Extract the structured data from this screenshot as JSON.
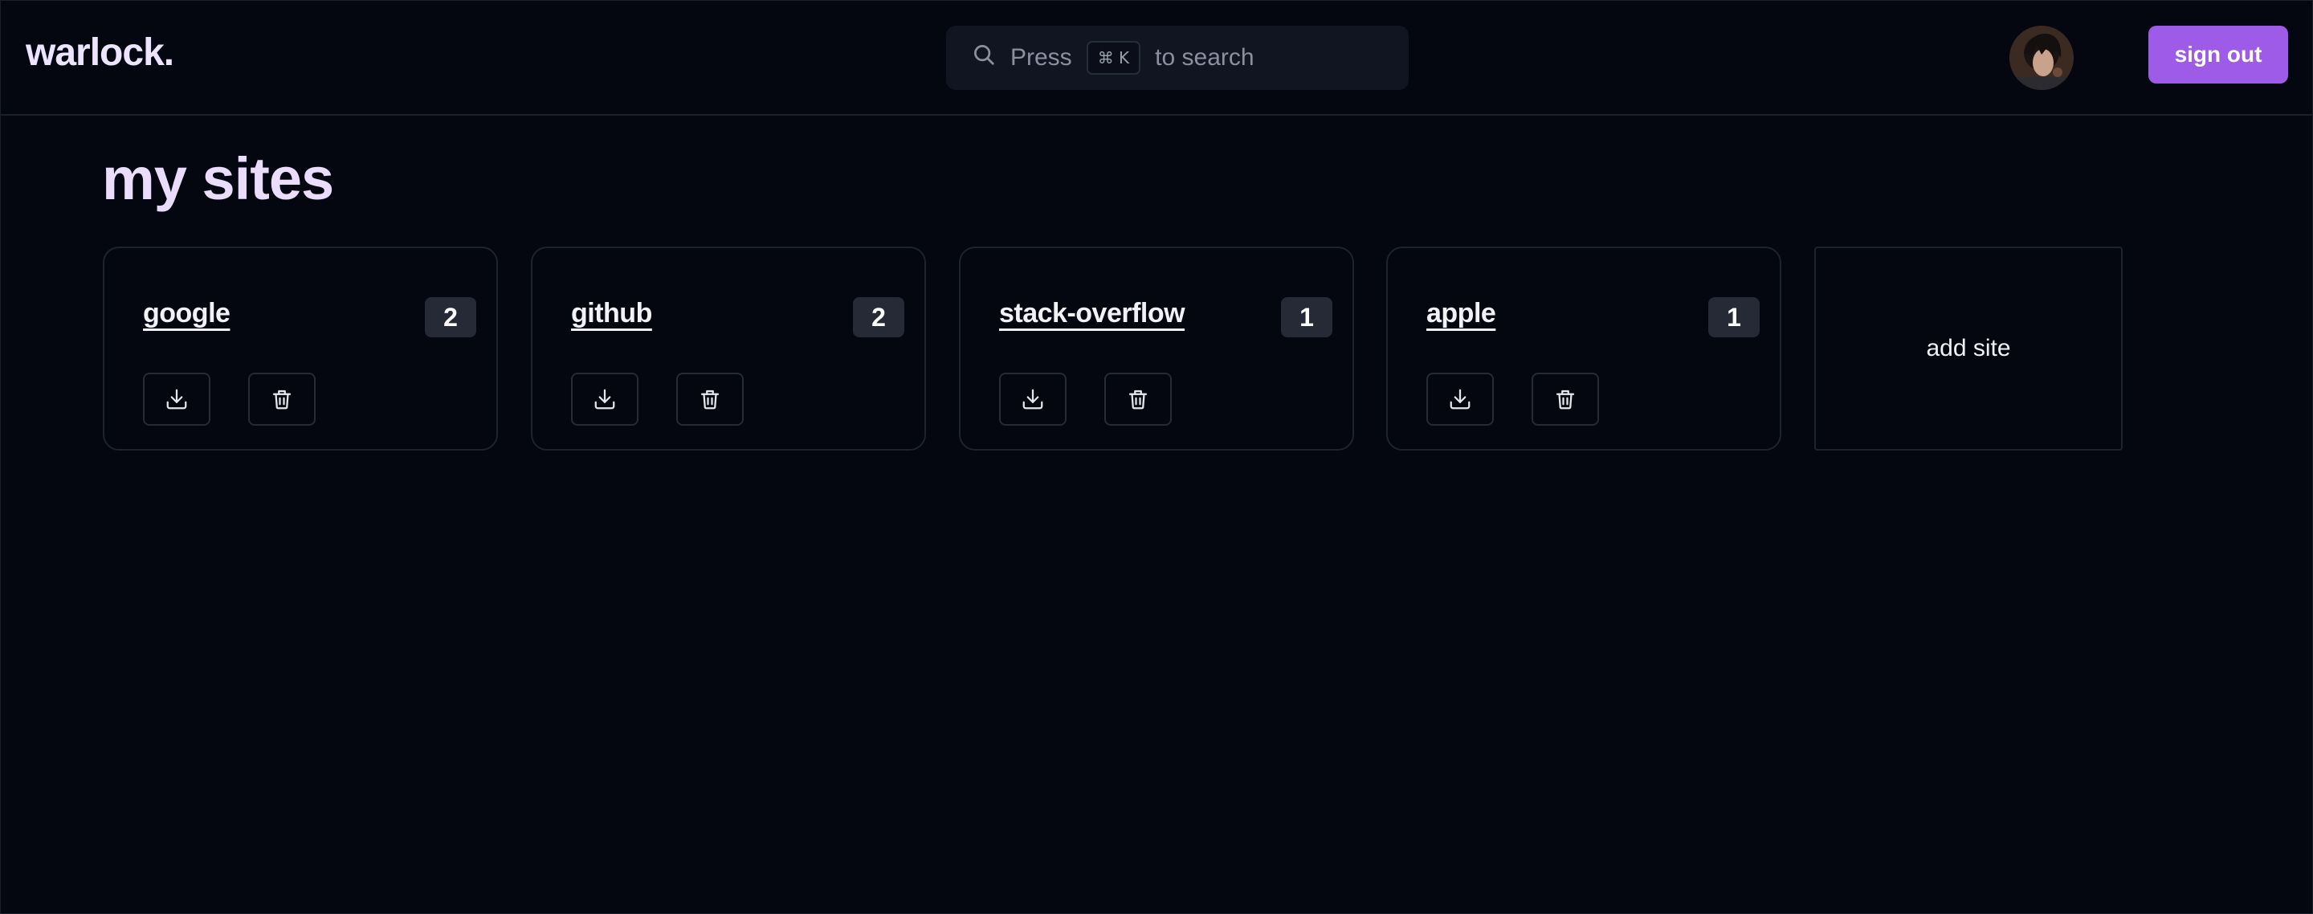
{
  "header": {
    "logo": "warlock.",
    "search": {
      "prefix": "Press",
      "shortcut": "⌘ K",
      "suffix": "to search"
    },
    "sign_out_label": "sign out"
  },
  "main": {
    "title": "my sites",
    "sites": [
      {
        "name": "google",
        "count": "2"
      },
      {
        "name": "github",
        "count": "2"
      },
      {
        "name": "stack-overflow",
        "count": "1"
      },
      {
        "name": "apple",
        "count": "1"
      }
    ],
    "add_site_label": "add site"
  },
  "colors": {
    "background": "#040610",
    "accent": "#9d5be8",
    "title": "#eadcfb"
  },
  "icons": {
    "search": "search-icon",
    "download": "download-icon",
    "delete": "trash-icon"
  }
}
